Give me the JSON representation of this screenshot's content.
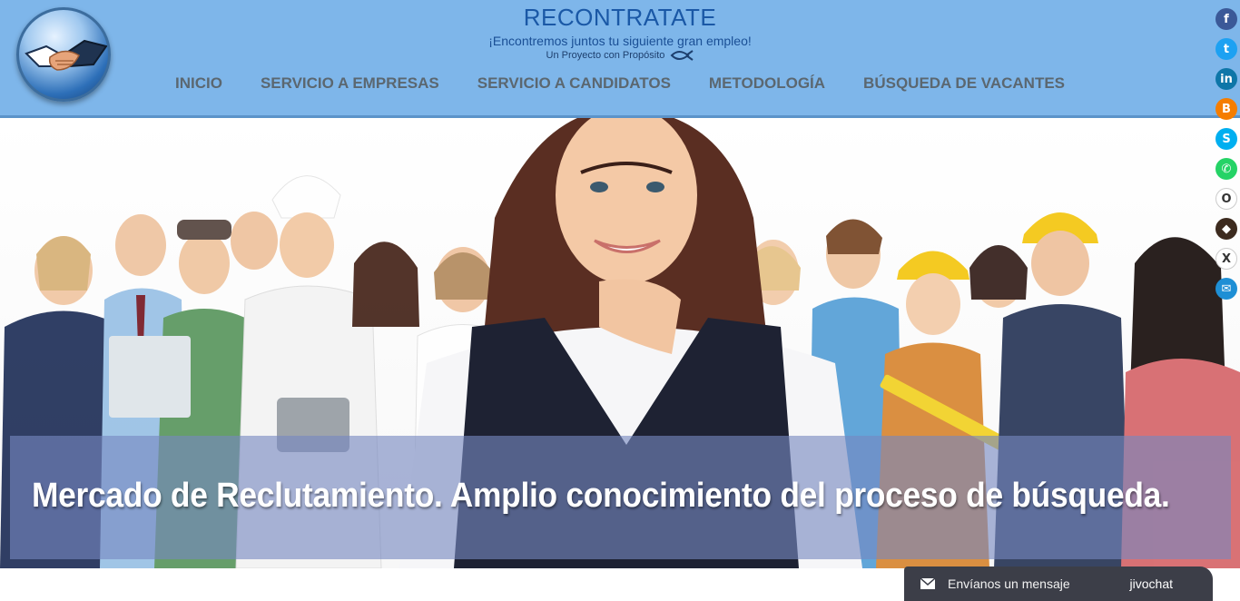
{
  "header": {
    "title": "RECONTRATATE",
    "tagline": "¡Encontremos juntos tu siguiente gran empleo!",
    "purpose": "Un Proyecto con Propósito",
    "logo_icon": "handshake-icon",
    "bg_color": "#7eb6ea"
  },
  "nav": {
    "items": [
      {
        "label": "INICIO"
      },
      {
        "label": "SERVICIO A EMPRESAS"
      },
      {
        "label": "SERVICIO A CANDIDATOS"
      },
      {
        "label": "METODOLOGÍA"
      },
      {
        "label": "BÚSQUEDA DE VACANTES"
      }
    ]
  },
  "social": [
    {
      "icon": "facebook-icon",
      "color": "#3b5998",
      "glyph": "f"
    },
    {
      "icon": "twitter-icon",
      "color": "#1da1f2",
      "glyph": "t"
    },
    {
      "icon": "linkedin-icon",
      "color": "#0e76a8",
      "glyph": "in"
    },
    {
      "icon": "blogger-icon",
      "color": "#f57d00",
      "glyph": "B"
    },
    {
      "icon": "skype-icon",
      "color": "#00aff0",
      "glyph": "S"
    },
    {
      "icon": "whatsapp-icon",
      "color": "#25d366",
      "glyph": "✆"
    },
    {
      "icon": "pinterest-icon",
      "color": "#ffffff",
      "glyph": "O"
    },
    {
      "icon": "fox-icon",
      "color": "#3d2b1f",
      "glyph": "◆"
    },
    {
      "icon": "xing-icon",
      "color": "#ffffff",
      "glyph": "X"
    },
    {
      "icon": "email-icon",
      "color": "#1e8fd5",
      "glyph": "✉"
    }
  ],
  "hero": {
    "caption": "Mercado de Reclutamiento. Amplio conocimiento del proceso de búsqueda."
  },
  "chat": {
    "label": "Envíanos un mensaje",
    "brand": "jivochat"
  }
}
